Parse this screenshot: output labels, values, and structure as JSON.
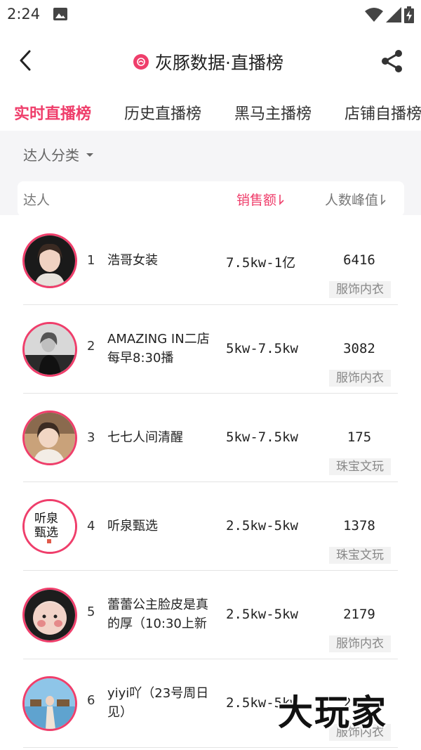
{
  "status_bar": {
    "time": "2:24",
    "icons": [
      "gallery-icon",
      "wifi-icon",
      "signal-icon",
      "battery-charging-icon"
    ]
  },
  "app_bar": {
    "title": "灰豚数据·直播榜",
    "logo_icon": "huitun-logo-icon",
    "back_icon": "back-arrow-icon",
    "share_icon": "share-icon"
  },
  "tabs": [
    {
      "label": "实时直播榜",
      "active": true
    },
    {
      "label": "历史直播榜",
      "active": false
    },
    {
      "label": "黑马主播榜",
      "active": false
    },
    {
      "label": "店铺自播榜",
      "active": false
    }
  ],
  "filter": {
    "label": "达人分类"
  },
  "table_header": {
    "talent": "达人",
    "sales": "销售额",
    "peak": "人数峰值"
  },
  "rows": [
    {
      "rank": "1",
      "name": "浩哥女装",
      "sales": "7.5kw-1亿",
      "peak": "6416",
      "category": "服饰内衣"
    },
    {
      "rank": "2",
      "name": "AMAZING IN二店每早8:30播",
      "sales": "5kw-7.5kw",
      "peak": "3082",
      "category": "服饰内衣"
    },
    {
      "rank": "3",
      "name": "七七人间清醒",
      "sales": "5kw-7.5kw",
      "peak": "175",
      "category": "珠宝文玩"
    },
    {
      "rank": "4",
      "name": "听泉甄选",
      "sales": "2.5kw-5kw",
      "peak": "1378",
      "category": "珠宝文玩"
    },
    {
      "rank": "5",
      "name": "蕾蕾公主脸皮是真的厚（10:30上新",
      "sales": "2.5kw-5kw",
      "peak": "2179",
      "category": "服饰内衣"
    },
    {
      "rank": "6",
      "name": "yiyi吖（23号周日见）",
      "sales": "2.5kw-5kw",
      "peak": "2286",
      "category": "服饰内衣"
    }
  ],
  "avatar_4_text": "听泉甄选",
  "watermark": "大玩家",
  "colors": {
    "accent": "#ef3e6b",
    "text_primary": "#222222",
    "text_secondary": "#777777",
    "tag_bg": "#f2f2f2",
    "page_gray": "#f5f5f7"
  }
}
